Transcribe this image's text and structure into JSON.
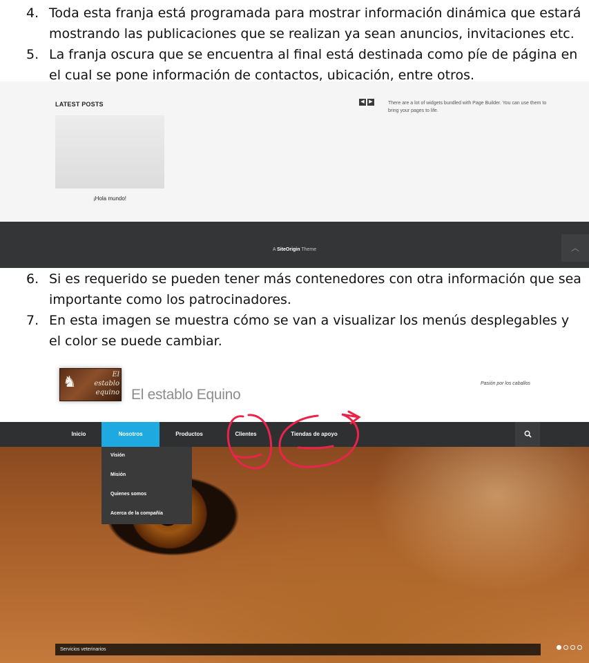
{
  "list_top": [
    {
      "num": "4.",
      "text": "Toda esta franja está programada para mostrar información dinámica que estará mostrando las publicaciones que se realizan ya sean anuncios, invitaciones etc."
    },
    {
      "num": "5.",
      "text": "La franja oscura que se encuentra al final está destinada como píe de página en el cual se pone información de contactos, ubicación, entre otros."
    }
  ],
  "shot1": {
    "latest_posts_title": "LATEST POSTS",
    "post_caption": "¡Hola mundo!",
    "prev_icon": "chevron-left-icon",
    "next_icon": "chevron-right-icon",
    "widget_text": "There are a lot of widgets bundled with Page Builder. You can use them to bring your pages to life.",
    "footer_prefix": "A ",
    "footer_brand": "SiteOrigin",
    "footer_suffix": " Theme",
    "back_to_top_icon": "chevron-up-icon",
    "footer_color": "#333536"
  },
  "list_mid": [
    {
      "num": "6.",
      "text": "Si es requerido se pueden tener más contenedores con otra información que sea importante como los patrocinadores."
    },
    {
      "num": "7.",
      "text": "En esta imagen se muestra cómo se van a visualizar los menús desplegables y el color se puede cambiar."
    }
  ],
  "shot2": {
    "logo_text_1": "El",
    "logo_text_2": "establo",
    "logo_text_3": "equino",
    "site_name": "El establo Equino",
    "tagline": "Pasión por los caballos",
    "nav": [
      "Inicio",
      "Nosotros",
      "Productos",
      "Clientes",
      "Tiendas de apoyo"
    ],
    "active_nav": "Nosotros",
    "accent_color": "#1ea9e1",
    "search_icon": "search-icon",
    "dropdown": [
      "Visión",
      "Misión",
      "Quienes somos",
      "Acerca de la compañía"
    ],
    "slider_caption": "Servicios veterinarios",
    "slider_dots": 4,
    "annotation_color": "#e8244a"
  }
}
